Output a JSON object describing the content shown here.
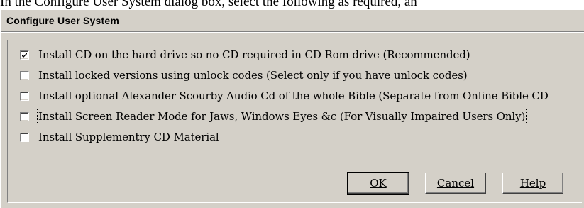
{
  "background_text": "In the Configure User System dialog box, select the following as required, an",
  "dialog": {
    "title": "Configure User System",
    "options": [
      {
        "label": "Install CD on the hard drive so no CD required in CD Rom drive (Recommended)",
        "checked": true
      },
      {
        "label": "Install locked versions using unlock codes (Select only if you have unlock codes)",
        "checked": false
      },
      {
        "label": "Install optional Alexander Scourby Audio Cd of the whole Bible (Separate from Online Bible CD",
        "checked": false
      },
      {
        "label": "Install Screen Reader Mode for Jaws, Windows Eyes &c (For Visually Impaired Users Only)",
        "checked": false,
        "focused": true
      },
      {
        "label": "Install Supplementry CD Material",
        "checked": false
      }
    ],
    "buttons": {
      "ok": "OK",
      "cancel": "Cancel",
      "help": "Help"
    }
  },
  "colors": {
    "dialog_face": "#d4d0c8",
    "shadow": "#808080",
    "highlight": "#ffffff"
  }
}
